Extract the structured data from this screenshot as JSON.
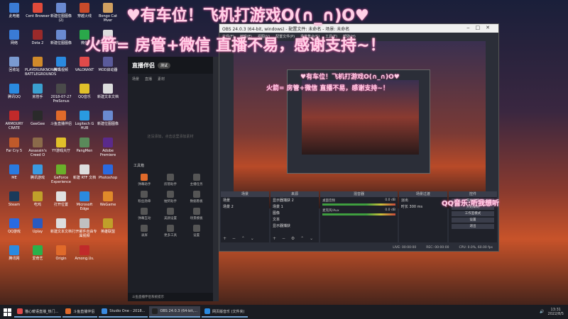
{
  "desktop": {
    "icons": [
      {
        "label": "此电脑",
        "color": "#3a7bd5"
      },
      {
        "label": "Cent Browser",
        "color": "#e04a3a"
      },
      {
        "label": "新建位图图像 (2)",
        "color": "#6a8ad0"
      },
      {
        "label": "穿越火线",
        "color": "#c84a2a"
      },
      {
        "label": "Bongo Cat Mver",
        "color": "#d0a060"
      },
      {
        "label": "网络",
        "color": "#3a7bd5"
      },
      {
        "label": "Dota 2",
        "color": "#9a2a2a"
      },
      {
        "label": "新建位图图像",
        "color": "#6a8ad0"
      },
      {
        "label": "微信",
        "color": "#2aa84a"
      },
      {
        "label": "新建文本文档",
        "color": "#ddd"
      },
      {
        "label": "回收站",
        "color": "#7a9ad0"
      },
      {
        "label": "PLAYERUNKNOWN'S BATTLEGROUNDS",
        "color": "#d08a2a"
      },
      {
        "label": "腾讯视频",
        "color": "#2a8ae0"
      },
      {
        "label": "VALORANT",
        "color": "#e04a4a"
      },
      {
        "label": "MOD启动器",
        "color": "#5a5a9a"
      },
      {
        "label": "腾讯QQ",
        "color": "#2a8ae0"
      },
      {
        "label": "房管手",
        "color": "#3aa0d0"
      },
      {
        "label": "2018-07-27 PreSonus",
        "color": "#4a4a4a"
      },
      {
        "label": "QQ音乐",
        "color": "#e0c02a"
      },
      {
        "label": "新建文本文档",
        "color": "#ddd"
      },
      {
        "label": "ARMOURY CRATE",
        "color": "#c02a2a"
      },
      {
        "label": "GeeGee",
        "color": "#2a2a2a"
      },
      {
        "label": "斗鱼直播伴侣",
        "color": "#e06a2a"
      },
      {
        "label": "Logitech G HUB",
        "color": "#2a9ae0"
      },
      {
        "label": "新建位图图像",
        "color": "#6a8ad0"
      },
      {
        "label": "Far Cry 5",
        "color": "#c05a2a"
      },
      {
        "label": "Assassin's Creed O",
        "color": "#8a6a4a"
      },
      {
        "label": "YY游戏大厅",
        "color": "#e0c02a"
      },
      {
        "label": "PangMen",
        "color": "#5a8a5a"
      },
      {
        "label": "Adobe Premiere",
        "color": "#5a2a8a"
      },
      {
        "label": "ME",
        "color": "#2a7ae0"
      },
      {
        "label": "腾讯游戏",
        "color": "#3a9ae0"
      },
      {
        "label": "GeForce Experience",
        "color": "#6ab02a"
      },
      {
        "label": "新建 RTF 文档",
        "color": "#ddd"
      },
      {
        "label": "Photoshop",
        "color": "#2a6ae0"
      },
      {
        "label": "Steam",
        "color": "#1a3a5a"
      },
      {
        "label": "吃鸡",
        "color": "#c0a02a"
      },
      {
        "label": "打开位置",
        "color": "#e0e0e0"
      },
      {
        "label": "Microsoft Edge",
        "color": "#2a8ae0"
      },
      {
        "label": "WeGame",
        "color": "#e08a2a"
      },
      {
        "label": "QQ游戏",
        "color": "#2a6ae0"
      },
      {
        "label": "Uplay",
        "color": "#2a5ac0"
      },
      {
        "label": "新建文本文档",
        "color": "#ddd"
      },
      {
        "label": "打开邮件自由专属视频",
        "color": "#c0c0c0"
      },
      {
        "label": "英雄联盟",
        "color": "#c0a02a"
      },
      {
        "label": "腾讯网",
        "color": "#2a8ae0"
      },
      {
        "label": "爱奇艺",
        "color": "#2ab04a"
      },
      {
        "label": "Origin",
        "color": "#e06a2a"
      },
      {
        "label": "Among.Us.",
        "color": "#c02a2a"
      }
    ]
  },
  "overlay": {
    "line1": "♥有车位！飞机打游戏O(∩_∩)O♥",
    "line2": "火箭= 房管+微信 直播不易，感谢支持~！",
    "music": "QQ音乐:听我想听"
  },
  "streamer_app": {
    "logo": "直播伴侣",
    "badge": "测试",
    "tabs": [
      "场景",
      "直播",
      "素材"
    ],
    "empty_hint": "还没添加，点击这里添加素材",
    "tools_title": "工具箱",
    "tools": [
      "弹幕助手",
      "房管助手",
      "主播任务",
      "粉丝勋章",
      "抽奖助手",
      "数据看板",
      "弹幕互动",
      "美颜设置",
      "场景模板",
      "录屏",
      "更多工具",
      "设置"
    ],
    "footer": "斗鱼直播伴侣系统提示"
  },
  "obs": {
    "title": "OBS 24.0.3 (64-bit, windows) - 配置文件: 未命名 - 场景: 未命名",
    "menu": [
      "文件(F)",
      "编辑(E)",
      "视图(V)",
      "配置文件(P)",
      "场景集合(S)",
      "工具(T)",
      "帮助(H)"
    ],
    "docks": {
      "scenes": {
        "header": "场景",
        "items": [
          "场景",
          "场景 2"
        ]
      },
      "sources": {
        "header": "来源",
        "items": [
          "显示器捕获 2",
          "场景 1",
          "图像",
          "文本",
          "显示器捕获"
        ]
      },
      "mixer": {
        "header": "混音器",
        "rows": [
          {
            "name": "桌面音频",
            "db": "0.0 dB"
          },
          {
            "name": "麦克风/Aux",
            "db": "0.0 dB"
          }
        ]
      },
      "transitions": {
        "header": "场景过渡",
        "type": "淡出",
        "duration_label": "时长",
        "duration": "300 ms"
      },
      "controls": {
        "header": "控件",
        "buttons": [
          "开始推流",
          "开始录制",
          "工作室模式",
          "设置",
          "退出"
        ]
      }
    },
    "status": {
      "live": "LIVE: 00:00:00",
      "rec": "REC: 00:00:00",
      "cpu": "CPU: 0.0%, 60.00 fps"
    }
  },
  "taskbar": {
    "items": [
      {
        "label": "猫心暖语直播_热门...",
        "color": "#e04a4a",
        "active": false
      },
      {
        "label": "斗鱼直播伴侣",
        "color": "#e06a2a",
        "active": false
      },
      {
        "label": "Studio One - 2018...",
        "color": "#3a8ae0",
        "active": false
      },
      {
        "label": "OBS 24.0.3 (64-bit,...",
        "color": "#222",
        "active": true
      },
      {
        "label": "网页版音乐 (文件夹)",
        "color": "#2a8ae0",
        "active": false
      }
    ],
    "time": "13:31",
    "date": "2022/8/5"
  }
}
